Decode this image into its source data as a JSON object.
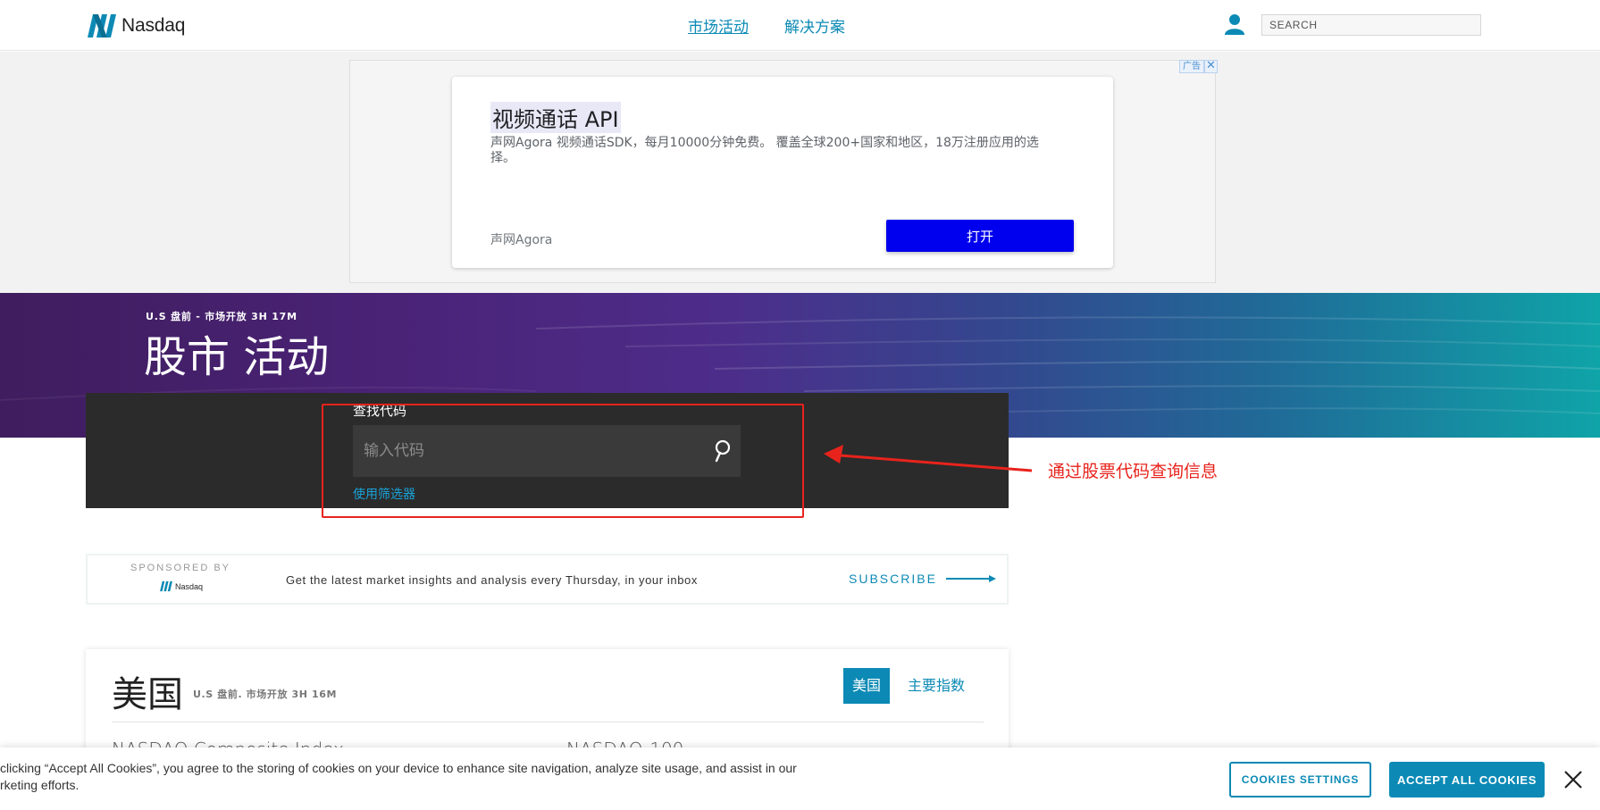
{
  "header": {
    "logo_text": "Nasdaq",
    "nav": [
      {
        "label": "市场活动",
        "active": true
      },
      {
        "label": "解决方案",
        "active": false
      }
    ],
    "search_placeholder": "SEARCH"
  },
  "ad": {
    "flag_label": "广告",
    "close_glyph": "✕",
    "title": "视频通话 API",
    "description": "声网Agora 视频通话SDK，每月10000分钟免费。 覆盖全球200+国家和地区，18万注册应用的选择。",
    "brand": "声网Agora",
    "button_label": "打开"
  },
  "hero": {
    "status": "U.S 盘前 - 市场开放 3H 17M",
    "title": "股市 活动"
  },
  "symbol_search": {
    "label": "查找代码",
    "placeholder": "输入代码",
    "screener_link": "使用筛选器"
  },
  "annotation": {
    "text": "通过股票代码查询信息",
    "color": "#e8231c"
  },
  "sponsor": {
    "sponsored_by": "SPONSORED BY",
    "logo_text": "Nasdaq",
    "text": "Get the latest market insights and analysis every Thursday, in your inbox",
    "subscribe_label": "SUBSCRIBE"
  },
  "us_card": {
    "title": "美国",
    "status": "U.S 盘前. 市场开放 3H 16M",
    "tabs": [
      {
        "label": "美国",
        "active": true
      },
      {
        "label": "主要指数",
        "active": false
      }
    ],
    "rows": [
      "NASDAQ Composite Index",
      "NASDAQ-100"
    ]
  },
  "cookie": {
    "text": "clicking “Accept All Cookies”, you agree to the storing of cookies on your device to enhance site navigation, analyze site usage, and assist in our rketing efforts.",
    "settings_label": "COOKIES SETTINGS",
    "accept_label": "ACCEPT ALL COOKIES"
  },
  "colors": {
    "brand_blue": "#0c8ab5",
    "ad_button": "#0000ee",
    "panel_dark": "#2b2b2b"
  }
}
